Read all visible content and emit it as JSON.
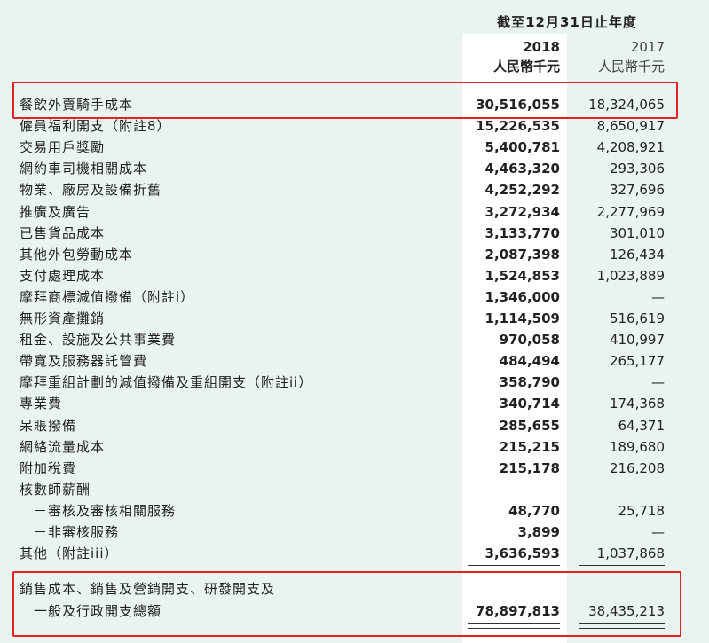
{
  "header": {
    "period": "截至12月31日止年度",
    "col_2018_year": "2018",
    "col_2018_unit": "人民幣千元",
    "col_2017_year": "2017",
    "col_2017_unit": "人民幣千元"
  },
  "rows": [
    {
      "label": "餐飲外賣騎手成本",
      "v2018": "30,516,055",
      "v2017": "18,324,065"
    },
    {
      "label": "僱員福利開支（附註8）",
      "v2018": "15,226,535",
      "v2017": "8,650,917"
    },
    {
      "label": "交易用戶獎勵",
      "v2018": "5,400,781",
      "v2017": "4,208,921"
    },
    {
      "label": "網約車司機相關成本",
      "v2018": "4,463,320",
      "v2017": "293,306"
    },
    {
      "label": "物業、廠房及設備折舊",
      "v2018": "4,252,292",
      "v2017": "327,696"
    },
    {
      "label": "推廣及廣告",
      "v2018": "3,272,934",
      "v2017": "2,277,969"
    },
    {
      "label": "已售貨品成本",
      "v2018": "3,133,770",
      "v2017": "301,010"
    },
    {
      "label": "其他外包勞動成本",
      "v2018": "2,087,398",
      "v2017": "126,434"
    },
    {
      "label": "支付處理成本",
      "v2018": "1,524,853",
      "v2017": "1,023,889"
    },
    {
      "label": "摩拜商標減值撥備（附註i）",
      "v2018": "1,346,000",
      "v2017": "—"
    },
    {
      "label": "無形資產攤銷",
      "v2018": "1,114,509",
      "v2017": "516,619"
    },
    {
      "label": "租金、設施及公共事業費",
      "v2018": "970,058",
      "v2017": "410,997"
    },
    {
      "label": "帶寬及服務器託管費",
      "v2018": "484,494",
      "v2017": "265,177"
    },
    {
      "label": "摩拜重組計劃的減值撥備及重組開支（附註ii）",
      "v2018": "358,790",
      "v2017": "—"
    },
    {
      "label": "專業費",
      "v2018": "340,714",
      "v2017": "174,368"
    },
    {
      "label": "呆賬撥備",
      "v2018": "285,655",
      "v2017": "64,371"
    },
    {
      "label": "網絡流量成本",
      "v2018": "215,215",
      "v2017": "189,680"
    },
    {
      "label": "附加稅費",
      "v2018": "215,178",
      "v2017": "216,208"
    },
    {
      "label": "核數師薪酬",
      "v2018": "",
      "v2017": ""
    },
    {
      "label": "－審核及審核相關服務",
      "v2018": "48,770",
      "v2017": "25,718"
    },
    {
      "label": "－非審核服務",
      "v2018": "3,899",
      "v2017": "—"
    },
    {
      "label": "其他（附註iii）",
      "v2018": "3,636,593",
      "v2017": "1,037,868"
    }
  ],
  "total": {
    "label_line1": "銷售成本、銷售及營銷開支、研發開支及",
    "label_line2": "一般及行政開支總額",
    "v2018": "78,897,813",
    "v2017": "38,435,213"
  },
  "colors": {
    "background": "#e9f3f1",
    "highlight": "#e02424"
  }
}
